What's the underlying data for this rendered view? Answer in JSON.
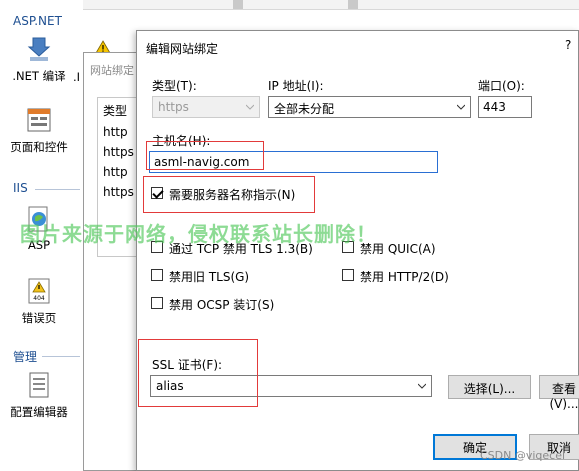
{
  "left_panel": {
    "top_header": "ASP.NET",
    "groups": [
      {
        "header": "IIS"
      },
      {
        "header": "管理"
      }
    ],
    "features": [
      {
        "label": ".NET 编译",
        "icon": "dotnet-compile-icon"
      },
      {
        "label": "页面和控件",
        "icon": "pages-controls-icon"
      },
      {
        "label": "ASP",
        "icon": "asp-icon"
      },
      {
        "label": "错误页",
        "icon": "error-page-icon",
        "icon_text": "404"
      },
      {
        "label": "配置编辑器",
        "icon": "config-editor-icon"
      }
    ],
    "cut_label": ".I"
  },
  "behind_dialog": {
    "title": "网站绑定",
    "column_type": "类型",
    "rows": [
      "http",
      "https",
      "http",
      "https"
    ]
  },
  "edit_dialog": {
    "title": "编辑网站绑定",
    "help": "?",
    "type_label": "类型(T):",
    "type_value": "https",
    "ip_label": "IP 地址(I):",
    "ip_value": "全部未分配",
    "port_label": "端口(O):",
    "port_value": "443",
    "host_label": "主机名(H):",
    "host_value": "asml-navig.com",
    "sni_label": "需要服务器名称指示(N)",
    "sni_checked": true,
    "options": [
      {
        "label": "通过 TCP 禁用 TLS 1.3(B)",
        "checked": false
      },
      {
        "label": "禁用 QUIC(A)",
        "checked": false
      },
      {
        "label": "禁用旧 TLS(G)",
        "checked": false
      },
      {
        "label": "禁用 HTTP/2(D)",
        "checked": false
      },
      {
        "label": "禁用 OCSP 装订(S)",
        "checked": false
      }
    ],
    "ssl_label": "SSL 证书(F):",
    "ssl_value": "alias",
    "select_button": "选择(L)...",
    "view_button": "查看(V)...",
    "ok_button": "确定",
    "cancel_button": "取消"
  },
  "watermark": "图片来源于网络，侵权联系站长删除！",
  "credit": "CSDN @viqecel",
  "colors": {
    "accent": "#0078d7",
    "highlight_box": "#e23a3a",
    "group_header": "#1e4f91",
    "watermark": "#50c85a"
  }
}
